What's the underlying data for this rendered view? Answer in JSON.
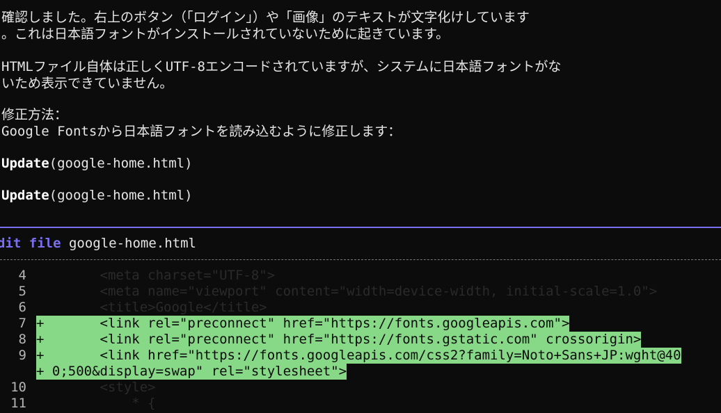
{
  "colors": {
    "background": "#0c0c0c",
    "text": "#e6e6e6",
    "accent": "#7a6ff0",
    "added_highlight": "#87d987",
    "context_code": "#2a2a2a"
  },
  "message": {
    "line1": "確認しました。右上のボタン（「ログイン」）や「画像」のテキストが文字化けしています",
    "line2": "。これは日本語フォントがインストールされていないために起きています。",
    "line3": "HTMLファイル自体は正しくUTF-8エンコードされていますが、システムに日本語フォントがな",
    "line4": "いため表示できていません。",
    "line5": "修正方法：",
    "line6": "Google Fontsから日本語フォントを読み込むように修正します："
  },
  "tool_calls": [
    {
      "name": "Update",
      "arg": "(google-home.html)"
    },
    {
      "name": "Update",
      "arg": "(google-home.html)"
    }
  ],
  "edit_panel": {
    "action": "dit file",
    "filename": "google-home.html"
  },
  "diff": [
    {
      "ln": "4",
      "marker": "",
      "code": "        <meta charset=\"UTF-8\">",
      "added": false
    },
    {
      "ln": "5",
      "marker": "",
      "code": "        <meta name=\"viewport\" content=\"width=device-width, initial-scale=1.0\">",
      "added": false
    },
    {
      "ln": "6",
      "marker": "",
      "code": "        <title>Google</title>",
      "added": false
    },
    {
      "ln": "7",
      "marker": "+",
      "code": "+       <link rel=\"preconnect\" href=\"https://fonts.googleapis.com\">",
      "added": true
    },
    {
      "ln": "8",
      "marker": "+",
      "code": "+       <link rel=\"preconnect\" href=\"https://fonts.gstatic.com\" crossorigin>",
      "added": true
    },
    {
      "ln": "9",
      "marker": "+",
      "code": "+       <link href=\"https://fonts.googleapis.com/css2?family=Noto+Sans+JP:wght@40",
      "added": true
    },
    {
      "ln": "",
      "marker": "+",
      "code": "+ 0;500&display=swap\" rel=\"stylesheet\">",
      "added": true
    },
    {
      "ln": "10",
      "marker": "",
      "code": "        <style>",
      "added": false
    },
    {
      "ln": "11",
      "marker": "",
      "code": "            * {",
      "added": false
    }
  ]
}
